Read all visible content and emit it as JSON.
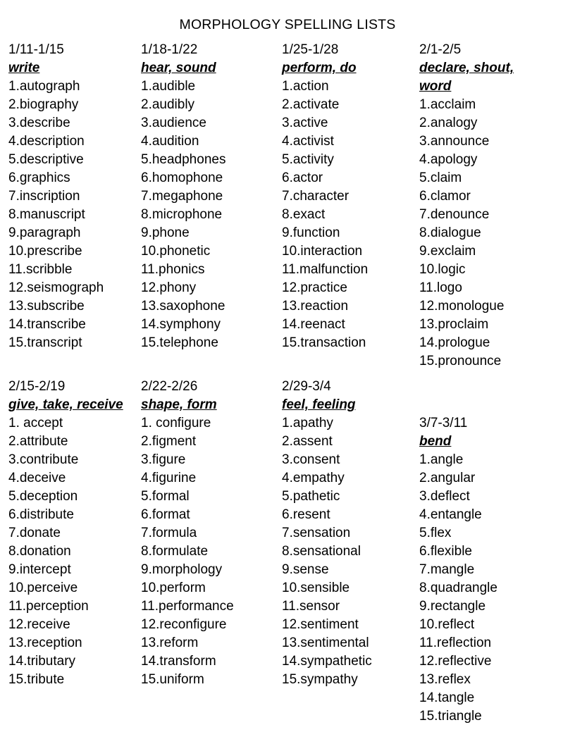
{
  "document": {
    "title": "MORPHOLOGY SPELLING LISTS",
    "text_color": "#000000",
    "background_color": "#ffffff"
  },
  "sections": [
    {
      "name": "section-1",
      "columns": [
        {
          "date_range": "1/11-1/15",
          "root_lines": [
            "write"
          ],
          "words": [
            "1.autograph",
            "2.biography",
            "3.describe",
            "4.description",
            "5.descriptive",
            "6.graphics",
            "7.inscription",
            "8.manuscript",
            "9.paragraph",
            "10.prescribe",
            "11.scribble",
            "12.seismograph",
            "13.subscribe",
            "14.transcribe",
            "15.transcript"
          ]
        },
        {
          "date_range": "1/18-1/22",
          "root_lines": [
            "hear, sound"
          ],
          "words": [
            "1.audible",
            "2.audibly",
            "3.audience",
            "4.audition",
            "5.headphones",
            "6.homophone",
            "7.megaphone",
            "8.microphone",
            "9.phone",
            "10.phonetic",
            "11.phonics",
            "12.phony",
            "13.saxophone",
            "14.symphony",
            "15.telephone"
          ]
        },
        {
          "date_range": "1/25-1/28",
          "root_lines": [
            "perform, do"
          ],
          "words": [
            "1.action",
            "2.activate",
            "3.active",
            "4.activist",
            "5.activity",
            "6.actor",
            "7.character",
            "8.exact",
            "9.function",
            "10.interaction",
            "11.malfunction",
            "12.practice",
            "13.reaction",
            "14.reenact",
            "15.transaction"
          ]
        },
        {
          "date_range": "2/1-2/5",
          "root_lines": [
            "declare, shout,",
            "word"
          ],
          "words": [
            "1.acclaim",
            "2.analogy",
            "3.announce",
            "4.apology",
            "5.claim",
            "6.clamor",
            "7.denounce",
            "8.dialogue",
            "9.exclaim",
            "10.logic",
            "11.logo",
            "12.monologue",
            "13.proclaim",
            "14.prologue",
            "15.pronounce"
          ]
        }
      ]
    },
    {
      "name": "section-2",
      "columns": [
        {
          "date_range": "2/15-2/19",
          "root_lines": [
            "give, take, receive"
          ],
          "words": [
            "1. accept",
            "2.attribute",
            "3.contribute",
            "4.deceive",
            "5.deception",
            "6.distribute",
            "7.donate",
            "8.donation",
            "9.intercept",
            "10.perceive",
            "11.perception",
            "12.receive",
            "13.reception",
            "14.tributary",
            "15.tribute"
          ]
        },
        {
          "date_range": "2/22-2/26",
          "root_lines": [
            "shape, form"
          ],
          "words": [
            "1. configure",
            "2.figment",
            "3.figure",
            "4.figurine",
            "5.formal",
            "6.format",
            "7.formula",
            "8.formulate",
            "9.morphology",
            "10.perform",
            "11.performance",
            "12.reconfigure",
            "13.reform",
            "14.transform",
            "15.uniform"
          ]
        },
        {
          "date_range": "2/29-3/4",
          "root_lines": [
            "feel, feeling"
          ],
          "words": [
            "1.apathy",
            "2.assent",
            "3.consent",
            "4.empathy",
            "5.pathetic",
            "6.resent",
            "7.sensation",
            "8.sensational",
            "9.sense",
            "10.sensible",
            "11.sensor",
            "12.sentiment",
            "13.sentimental",
            "14.sympathetic",
            "15.sympathy"
          ]
        },
        {
          "date_range": "3/7-3/11",
          "root_lines": [
            "bend"
          ],
          "line_offset": 1,
          "words": [
            "1.angle",
            "2.angular",
            "3.deflect",
            "4.entangle",
            "5.flex",
            "6.flexible",
            "7.mangle",
            "8.quadrangle",
            "9.rectangle",
            "10.reflect",
            "11.reflection",
            "12.reflective",
            "13.reflex",
            "14.tangle",
            "15.triangle"
          ]
        }
      ]
    }
  ]
}
